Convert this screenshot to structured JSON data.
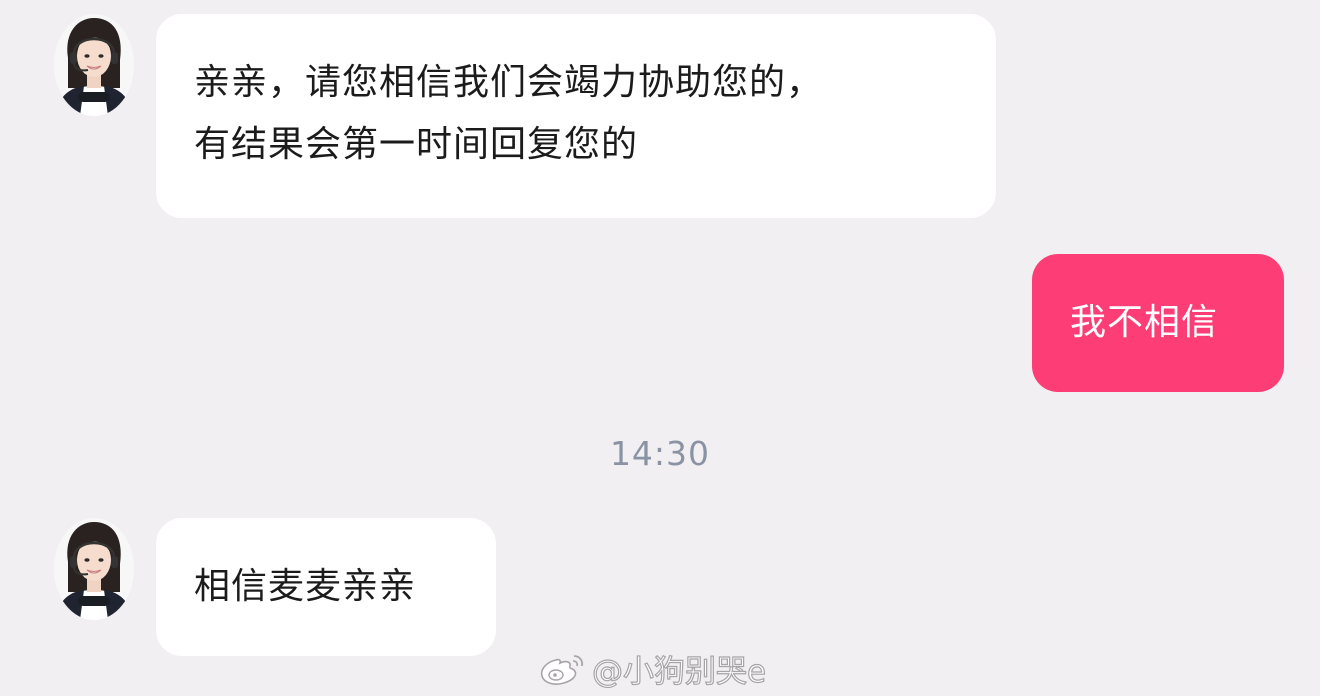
{
  "conversation": {
    "messages": [
      {
        "sender": "agent",
        "text": "亲亲，请您相信我们会竭力协助您的，\n有结果会第一时间回复您的"
      },
      {
        "sender": "user",
        "text": "我不相信"
      },
      {
        "sender": "agent",
        "text": "相信麦麦亲亲"
      }
    ],
    "timestamp": "14:30"
  },
  "watermark": {
    "icon": "weibo-logo-icon",
    "text": "@小狗别哭e"
  },
  "colors": {
    "background": "#f2eff3",
    "incoming_bubble": "#ffffff",
    "outgoing_bubble": "#fd3d76",
    "timestamp": "#8a93a3"
  }
}
